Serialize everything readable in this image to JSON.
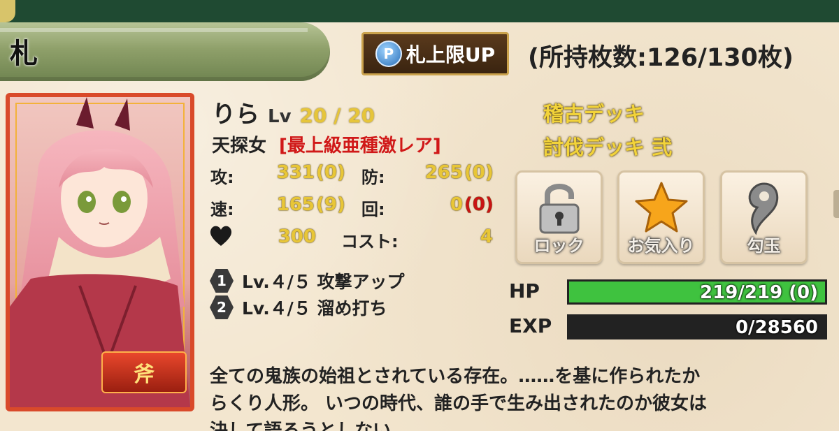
{
  "header": {
    "title": "札",
    "limit_up_button": {
      "icon": "P",
      "label": "札上限UP"
    },
    "card_count": "(所持枚数:126/130枚)"
  },
  "card": {
    "element_icon": "flame-axe-badge",
    "element_label": "斧",
    "name": "りら",
    "level_label": "Lv",
    "level": "20 / 20",
    "type": "天探女",
    "rarity": "[最上級亜種激レア]",
    "stats": {
      "atk_label": "攻:",
      "atk_value": "331",
      "atk_bonus": "(0)",
      "def_label": "防:",
      "def_value": "265",
      "def_bonus": "(0)",
      "spd_label": "速:",
      "spd_value": "165",
      "spd_bonus": "(9)",
      "eva_label": "回:",
      "eva_value": "0",
      "eva_bonus": "(0)",
      "heart_value": "300",
      "cost_label": "コスト:",
      "cost_value": "4"
    },
    "skills": [
      {
        "number": "1",
        "text": "Lv.４/５ 攻撃アップ"
      },
      {
        "number": "2",
        "text": "Lv.４/５ 溜め打ち"
      }
    ],
    "decks": [
      "稽古デッキ",
      "討伐デッキ 弐"
    ],
    "actions": [
      {
        "icon": "lock-open-icon",
        "label": "ロック"
      },
      {
        "icon": "star-icon",
        "label": "お気入り"
      },
      {
        "icon": "magatama-icon",
        "label": "勾玉"
      }
    ],
    "hp": {
      "label": "HP",
      "text": "219/219 (0)",
      "fraction": 1.0,
      "color": "#3fc23f"
    },
    "exp": {
      "label": "EXP",
      "text": "0/28560",
      "fraction": 0.0
    },
    "description": "全ての鬼族の始祖とされている存在。……を基に作られたか\nらくり人形。 いつの時代、誰の手で生み出されたのか彼女は\n決して語ろうとしない"
  }
}
